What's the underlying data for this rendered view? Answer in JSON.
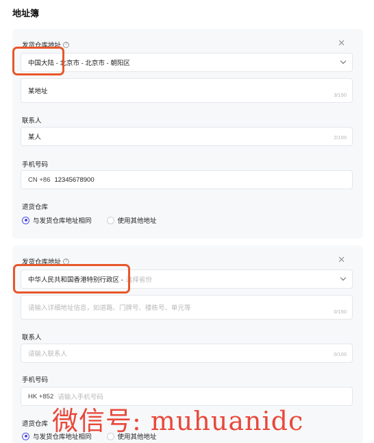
{
  "page": {
    "title": "地址簿"
  },
  "cards": [
    {
      "warehouse_label": "发货仓库地址",
      "region_value": "中国大陆 - 北京市 - 北京市 - 朝阳区",
      "address_value": "某地址",
      "address_counter": "3/150",
      "contact_label": "联系人",
      "contact_value": "某人",
      "contact_counter": "2/100",
      "phone_label": "手机号码",
      "phone_prefix": "CN +86",
      "phone_value": "12345678900",
      "return_label": "退货仓库",
      "return_options": [
        "与发货仓库地址相同",
        "使用其他地址"
      ],
      "return_selected": 0
    },
    {
      "warehouse_label": "发货仓库地址",
      "region_value": "中华人民共和国香港特别行政区 -",
      "region_placeholder": "选择省份",
      "address_placeholder": "请输入详细地址信息，如道路、门牌号、楼栋号、单元等",
      "address_counter": "0/150",
      "contact_label": "联系人",
      "contact_placeholder": "请输入联系人",
      "contact_counter": "0/100",
      "phone_label": "手机号码",
      "phone_prefix": "HK +852",
      "phone_placeholder": "请输入手机号码",
      "return_label": "退货仓库",
      "return_options": [
        "与发货仓库地址相同",
        "使用其他地址"
      ],
      "return_selected": 0
    }
  ],
  "annotations": {
    "highlight_color": "#e8562a"
  },
  "watermark": {
    "text": "微信号: muhuanidc",
    "color": "#e9483a"
  },
  "icons": {
    "help": "question-circle-icon",
    "close": "close-icon",
    "dropdown": "chevron-down-icon"
  }
}
